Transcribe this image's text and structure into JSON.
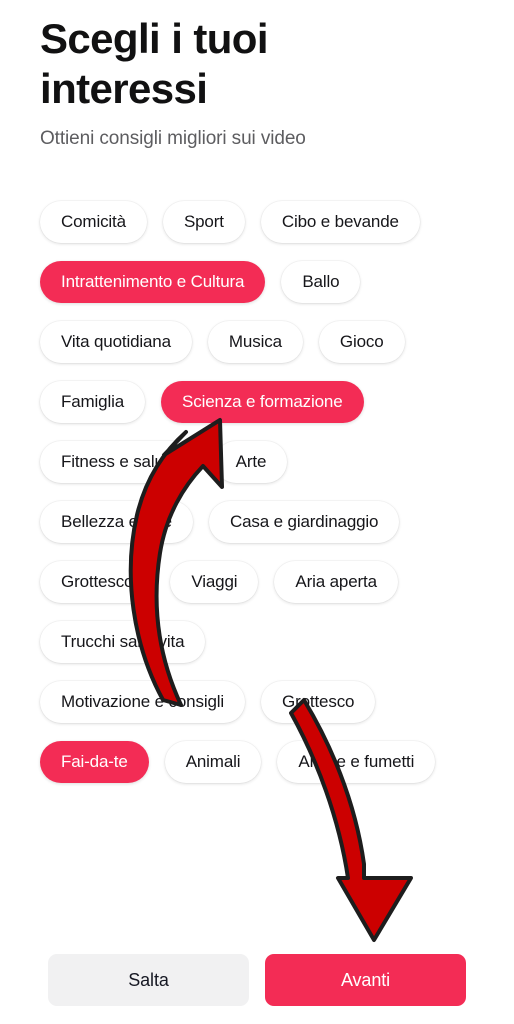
{
  "header": {
    "title": "Scegli i tuoi interessi",
    "subtitle": "Ottieni consigli migliori sui video"
  },
  "interests": {
    "rows": [
      [
        {
          "label": "Comicità",
          "selected": false
        },
        {
          "label": "Sport",
          "selected": false
        },
        {
          "label": "Cibo e bevande",
          "selected": false
        }
      ],
      [
        {
          "label": "Intrattenimento e Cultura",
          "selected": true
        },
        {
          "label": "Ballo",
          "selected": false
        }
      ],
      [
        {
          "label": "Vita quotidiana",
          "selected": false
        },
        {
          "label": "Musica",
          "selected": false
        },
        {
          "label": "Gioco",
          "selected": false
        }
      ],
      [
        {
          "label": "Famiglia",
          "selected": false
        },
        {
          "label": "Scienza e formazione",
          "selected": true
        }
      ],
      [
        {
          "label": "Fitness e salute",
          "selected": false
        },
        {
          "label": "Arte",
          "selected": false
        }
      ],
      [
        {
          "label": "Bellezza e stile",
          "selected": false
        },
        {
          "label": "Casa e giardinaggio",
          "selected": false
        }
      ],
      [
        {
          "label": "Grottesco",
          "selected": false
        },
        {
          "label": "Viaggi",
          "selected": false
        },
        {
          "label": "Aria aperta",
          "selected": false
        }
      ],
      [
        {
          "label": "Trucchi salvavita",
          "selected": false
        }
      ],
      [
        {
          "label": "Motivazione e consigli",
          "selected": false
        },
        {
          "label": "Grottesco",
          "selected": false
        }
      ],
      [
        {
          "label": "Fai-da-te",
          "selected": true
        },
        {
          "label": "Animali",
          "selected": false
        },
        {
          "label": "Anime e fumetti",
          "selected": false
        }
      ]
    ]
  },
  "footer": {
    "skip_label": "Salta",
    "next_label": "Avanti"
  },
  "annotations": {
    "arrow_fill": "#CC0000",
    "arrow_stroke": "#1d1d1d",
    "arrows": [
      {
        "name": "arrow-to-scienza-e-formazione",
        "direction": "up"
      },
      {
        "name": "arrow-to-avanti-button",
        "direction": "down"
      }
    ]
  },
  "colors": {
    "accent": "#F32C55",
    "background": "#FFFFFF",
    "chip_background": "#FFFFFF",
    "chip_text": "#16161A",
    "skip_background": "#F1F1F2",
    "title_text": "#111112",
    "subtitle_text": "#5D5D60"
  }
}
